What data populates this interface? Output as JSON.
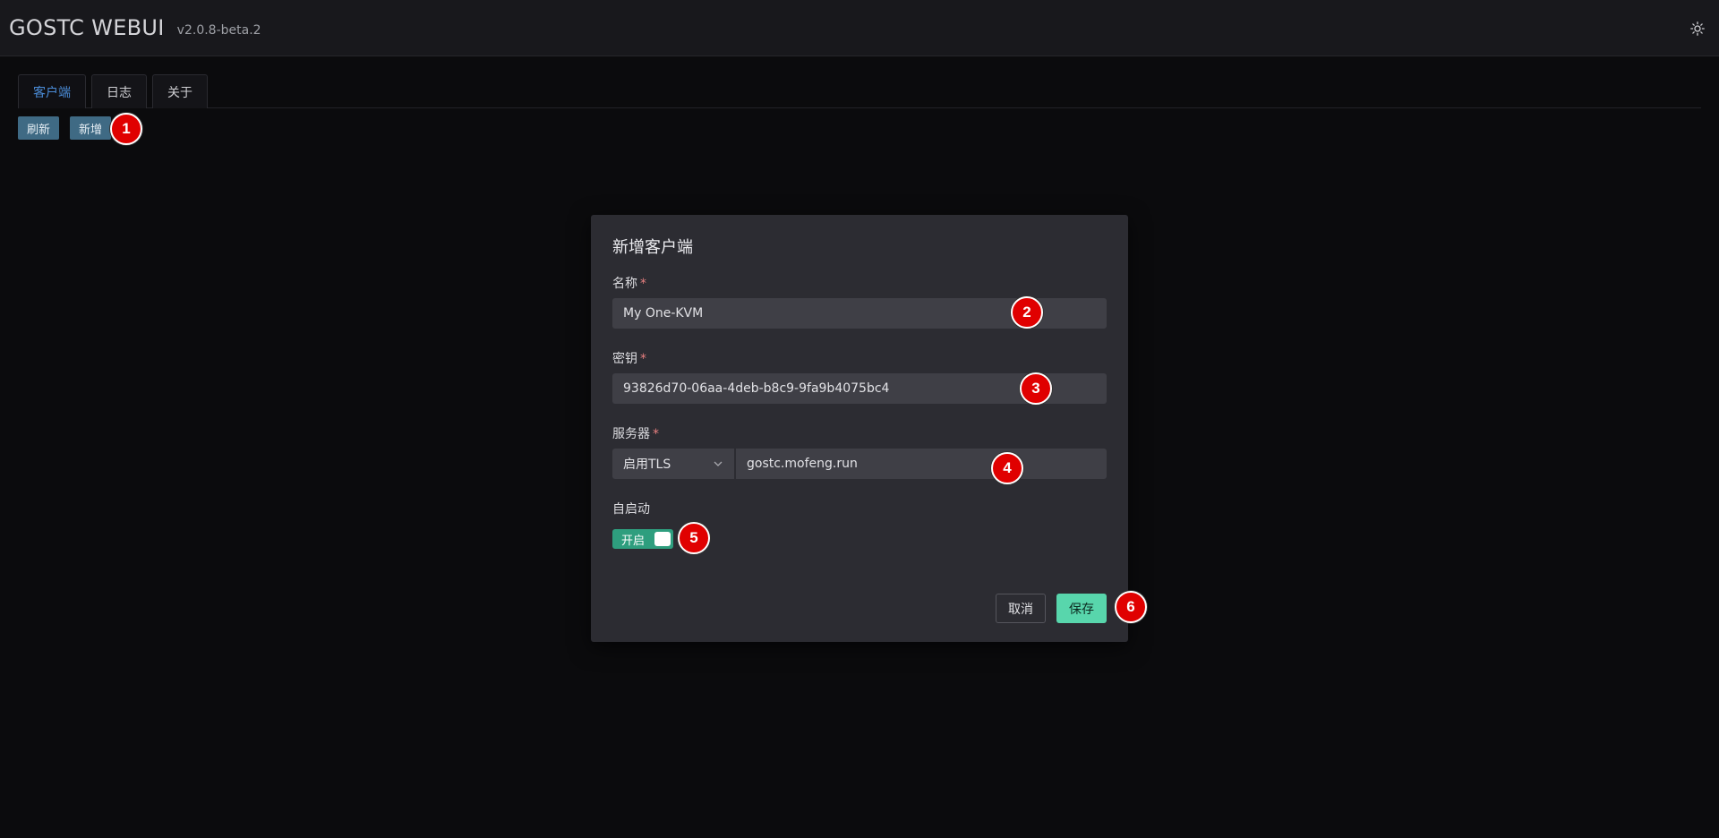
{
  "header": {
    "title": "GOSTC WEBUI",
    "version": "v2.0.8-beta.2"
  },
  "tabs": [
    {
      "label": "客户端",
      "active": true
    },
    {
      "label": "日志",
      "active": false
    },
    {
      "label": "关于",
      "active": false
    }
  ],
  "toolbar": {
    "refresh_label": "刷新",
    "add_label": "新增"
  },
  "modal": {
    "title": "新增客户端",
    "name_label": "名称",
    "name_value": "My One-KVM",
    "key_label": "密钥",
    "key_value": "93826d70-06aa-4deb-b8c9-9fa9b4075bc4",
    "server_label": "服务器",
    "tls_option": "启用TLS",
    "server_value": "gostc.mofeng.run",
    "autostart_label": "自启动",
    "autostart_switch_text": "开启",
    "required_mark": "*",
    "cancel_label": "取消",
    "save_label": "保存"
  },
  "markers": [
    "1",
    "2",
    "3",
    "4",
    "5",
    "6"
  ],
  "colors": {
    "accent": "#58d6ac",
    "switch_on": "#2e9e7e",
    "toolbar_button": "#3f6a84",
    "active_tab": "#4a8bd6",
    "marker": "#e00000"
  }
}
